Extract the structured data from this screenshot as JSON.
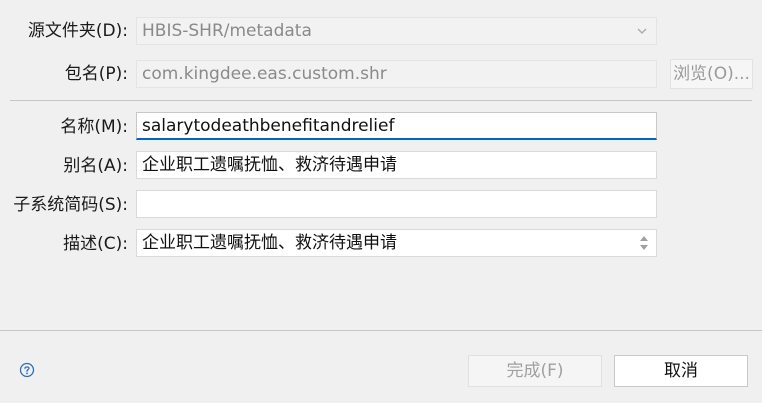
{
  "form": {
    "source_folder": {
      "label": "源文件夹(D):",
      "value": "HBIS-SHR/metadata"
    },
    "package": {
      "label": "包名(P):",
      "value": "com.kingdee.eas.custom.shr"
    },
    "browse_label": "浏览(O)...",
    "name": {
      "label": "名称(M):",
      "value": "salarytodeathbenefitandrelief"
    },
    "alias": {
      "label": "别名(A):",
      "value": "企业职工遗嘱抚恤、救济待遇申请"
    },
    "subsystem": {
      "label": "子系统简码(S):",
      "value": ""
    },
    "description": {
      "label": "描述(C):",
      "value": "企业职工遗嘱抚恤、救济待遇申请"
    }
  },
  "footer": {
    "finish_label": "完成(F)",
    "cancel_label": "取消"
  },
  "icons": {
    "help": "help-icon",
    "dropdown": "chevron-down-icon",
    "spinner": "scroll-arrows-icon"
  }
}
